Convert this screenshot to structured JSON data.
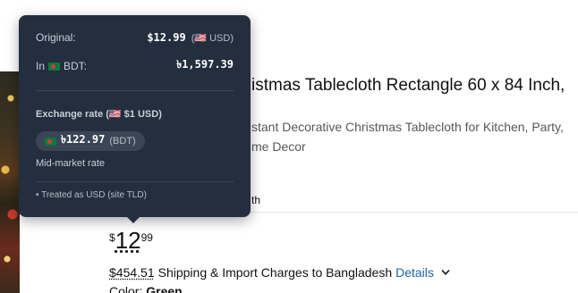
{
  "product": {
    "title": "istmas Tablecloth Rectangle 60 x 84 Inch,",
    "subtitle": "stant Decorative Christmas Tablecloth for Kitchen, Party, me Decor",
    "subtitle_line1": "stant Decorative Christmas Tablecloth for Kitchen, Party,",
    "subtitle_line2": "me Decor",
    "tab_fragment": "th",
    "price_symbol": "$",
    "price_whole": "12",
    "price_fraction": "99",
    "shipping_amount": "$454.51",
    "shipping_text": "Shipping & Import Charges to Bangladesh",
    "details_link": "Details",
    "color_label": "Color:",
    "color_value": "Green"
  },
  "tooltip": {
    "original_label": "Original:",
    "original_value": "$12.99",
    "original_currency": "(🇺🇸 USD)",
    "in_label_prefix": "In",
    "in_label_suffix": "BDT:",
    "in_value": "৳1,597.39",
    "exchange_rate_label": "Exchange rate (🇺🇸 $1 USD)",
    "rate_value": "৳122.97",
    "rate_currency": "(BDT)",
    "mid_market": "Mid-market rate",
    "footnote": "• Treated as USD (site TLD)"
  },
  "colors": {
    "tooltip_bg": "#232f3e",
    "link": "#2162a1",
    "text": "#0f1111"
  },
  "icons": [
    "us-flag-icon",
    "bd-flag-icon",
    "chevron-down-icon"
  ]
}
